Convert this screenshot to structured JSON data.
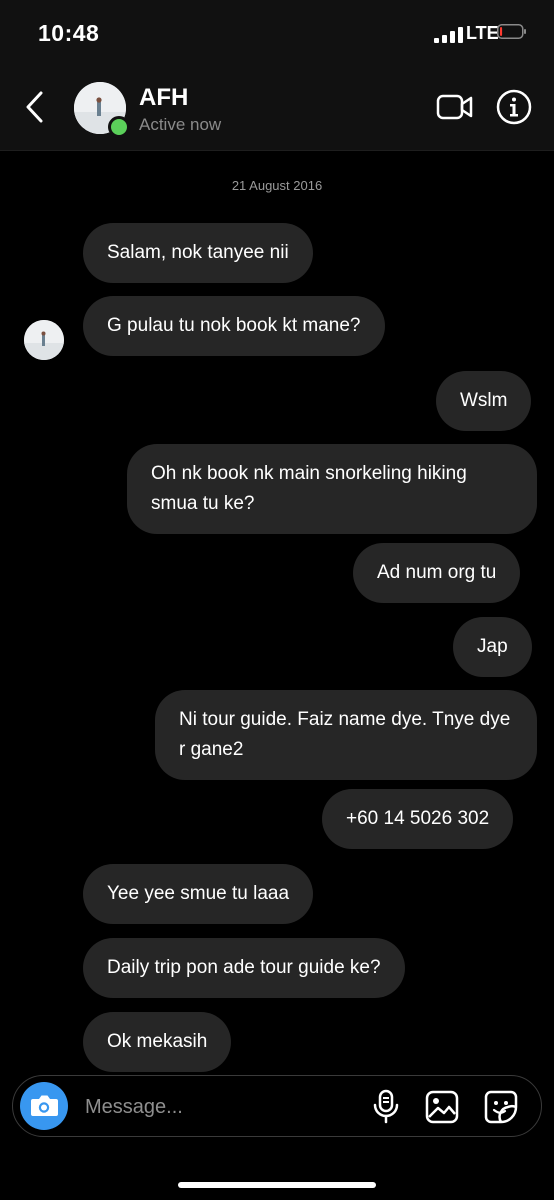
{
  "status_bar": {
    "time": "10:48",
    "network": "LTE",
    "battery_level": 0.1,
    "battery_color": "#ff3b30"
  },
  "header": {
    "back_icon": "chevron-left-icon",
    "contact_name": "AFH",
    "status": "Active now",
    "online_color": "#5bd05a",
    "video_icon": "video-camera-icon",
    "info_icon": "info-icon"
  },
  "chat": {
    "date": "21 August 2016",
    "messages": [
      {
        "from": "them",
        "text": "Salam, nok tanyee nii"
      },
      {
        "from": "them",
        "text": "G pulau tu nok book kt mane?"
      },
      {
        "from": "me",
        "text": "Wslm"
      },
      {
        "from": "me",
        "text": "Oh nk book nk main snorkeling hiking smua tu ke?"
      },
      {
        "from": "me",
        "text": "Ad num org tu"
      },
      {
        "from": "me",
        "text": "Jap"
      },
      {
        "from": "me",
        "text": "Ni tour guide. Faiz name dye. Tnye dye r gane2"
      },
      {
        "from": "me",
        "text": "+60 14 5026 302"
      },
      {
        "from": "them",
        "text": "Yee yee smue tu laaa"
      },
      {
        "from": "them",
        "text": "Daily trip pon ade tour guide ke?"
      },
      {
        "from": "them",
        "text": "Ok mekasih"
      }
    ]
  },
  "composer": {
    "placeholder": "Message...",
    "camera_icon": "camera-icon",
    "mic_icon": "microphone-icon",
    "gallery_icon": "gallery-icon",
    "sticker_icon": "sticker-icon",
    "accent": "#3897f0"
  }
}
